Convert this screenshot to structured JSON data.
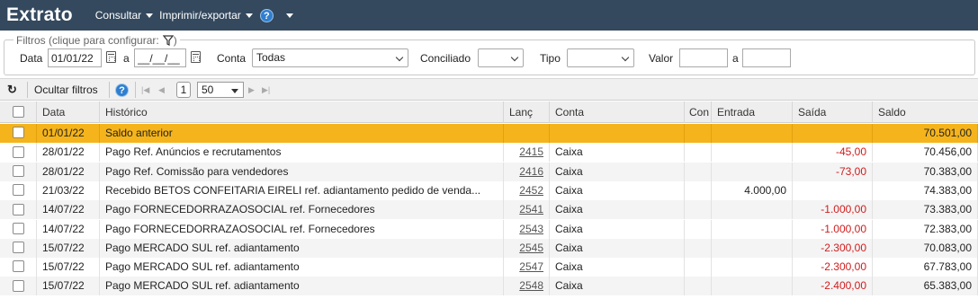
{
  "header": {
    "title": "Extrato",
    "menu_consultar": "Consultar",
    "menu_imprimir": "Imprimir/exportar",
    "help_glyph": "?"
  },
  "filters": {
    "legend": "Filtros (clique para configurar:",
    "legend_close": ")",
    "data_label": "Data",
    "date_from": "01/01/22",
    "a_label": "a",
    "date_to": "__/__/__",
    "conta_label": "Conta",
    "conta_value": "Todas",
    "conciliado_label": "Conciliado",
    "conciliado_value": "",
    "tipo_label": "Tipo",
    "tipo_value": "",
    "valor_label": "Valor",
    "valor_from": "",
    "valor_a_label": "a",
    "valor_to": ""
  },
  "toolbar": {
    "refresh_glyph": "↻",
    "ocultar_filtros": "Ocultar filtros",
    "help_glyph": "?",
    "page": "1",
    "page_size": "50",
    "first_glyph": "|◀",
    "prev_glyph": "◀",
    "next_glyph": "▶",
    "last_glyph": "▶|"
  },
  "table": {
    "columns": {
      "data": "Data",
      "historico": "Histórico",
      "lanc": "Lanç",
      "conta": "Conta",
      "con": "Con",
      "entrada": "Entrada",
      "saida": "Saída",
      "saldo": "Saldo"
    },
    "rows": [
      {
        "data": "01/01/22",
        "historico": "Saldo anterior",
        "lanc": "",
        "conta": "",
        "con": "",
        "entrada": "",
        "saida": "",
        "saldo": "70.501,00"
      },
      {
        "data": "28/01/22",
        "historico": "Pago Ref. Anúncios e recrutamentos",
        "lanc": "2415",
        "conta": "Caixa",
        "con": "",
        "entrada": "",
        "saida": "-45,00",
        "saldo": "70.456,00"
      },
      {
        "data": "28/01/22",
        "historico": "Pago Ref. Comissão para vendedores",
        "lanc": "2416",
        "conta": "Caixa",
        "con": "",
        "entrada": "",
        "saida": "-73,00",
        "saldo": "70.383,00"
      },
      {
        "data": "21/03/22",
        "historico": "Recebido BETOS CONFEITARIA EIRELI ref. adiantamento pedido de venda...",
        "lanc": "2452",
        "conta": "Caixa",
        "con": "",
        "entrada": "4.000,00",
        "saida": "",
        "saldo": "74.383,00"
      },
      {
        "data": "14/07/22",
        "historico": "Pago FORNECEDORRAZAOSOCIAL ref. Fornecedores",
        "lanc": "2541",
        "conta": "Caixa",
        "con": "",
        "entrada": "",
        "saida": "-1.000,00",
        "saldo": "73.383,00"
      },
      {
        "data": "14/07/22",
        "historico": "Pago FORNECEDORRAZAOSOCIAL ref. Fornecedores",
        "lanc": "2543",
        "conta": "Caixa",
        "con": "",
        "entrada": "",
        "saida": "-1.000,00",
        "saldo": "72.383,00"
      },
      {
        "data": "15/07/22",
        "historico": "Pago MERCADO SUL ref. adiantamento",
        "lanc": "2545",
        "conta": "Caixa",
        "con": "",
        "entrada": "",
        "saida": "-2.300,00",
        "saldo": "70.083,00"
      },
      {
        "data": "15/07/22",
        "historico": "Pago MERCADO SUL ref. adiantamento",
        "lanc": "2547",
        "conta": "Caixa",
        "con": "",
        "entrada": "",
        "saida": "-2.300,00",
        "saldo": "67.783,00"
      },
      {
        "data": "15/07/22",
        "historico": "Pago MERCADO SUL ref. adiantamento",
        "lanc": "2548",
        "conta": "Caixa",
        "con": "",
        "entrada": "",
        "saida": "-2.400,00",
        "saldo": "65.383,00"
      }
    ]
  },
  "colors": {
    "header_bg": "#34495e",
    "highlight_row": "#f5b41b",
    "negative": "#d01c1c",
    "help_blue": "#2f7fd0"
  }
}
